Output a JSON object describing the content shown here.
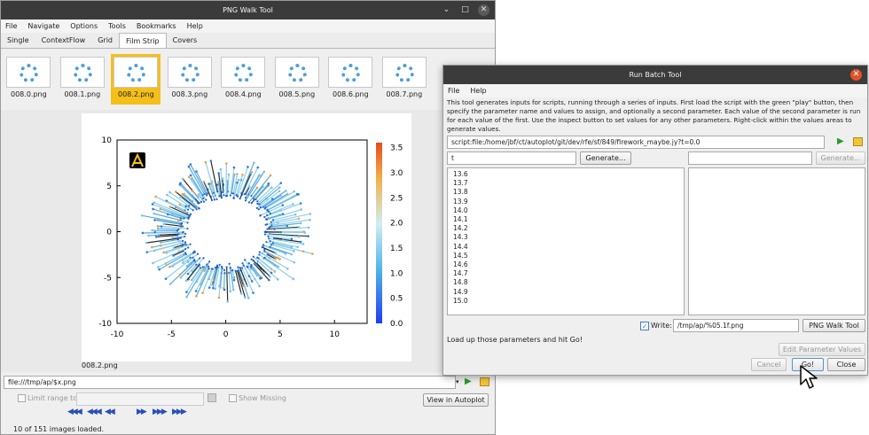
{
  "png_walk": {
    "title": "PNG Walk Tool",
    "menu": [
      "File",
      "Navigate",
      "Options",
      "Tools",
      "Bookmarks",
      "Help"
    ],
    "tabs": [
      "Single",
      "ContextFlow",
      "Grid",
      "Film Strip",
      "Covers"
    ],
    "active_tab": "Film Strip",
    "thumbnails": [
      "008.0.png",
      "008.1.png",
      "008.2.png",
      "008.3.png",
      "008.4.png",
      "008.5.png",
      "008.6.png",
      "008.7.png"
    ],
    "selected_thumbnail": "008.2.png",
    "image_caption": "008.2.png",
    "url_field": "file:///tmp/ap/$x.png",
    "limit_range_label": "Limit range to:",
    "show_missing_label": "Show Missing",
    "view_in_autoplot": "View in Autoplot",
    "status": "10 of 151 images loaded."
  },
  "chart_data": {
    "type": "scatter",
    "x_ticks": [
      "-10",
      "-5",
      "0",
      "5",
      "10"
    ],
    "y_ticks": [
      "10",
      "5",
      "0",
      "-5",
      "-10"
    ],
    "xlim": [
      -10,
      13
    ],
    "ylim": [
      -10,
      10
    ],
    "colorbar_ticks": [
      "3.5",
      "3.0",
      "2.5",
      "2.0",
      "1.5",
      "1.0",
      "0.5",
      "0.0"
    ],
    "colorbar_range": [
      0,
      3.6
    ],
    "ring_center": [
      0,
      0
    ],
    "ring_inner_radius": 3.5,
    "ring_outer_radius": 6.5
  },
  "batch": {
    "title": "Run Batch Tool",
    "menu": [
      "File",
      "Help"
    ],
    "description": "This tool generates inputs for scripts, running through a series of inputs. First load the script with the green \"play\" button, then specify the parameter name and values to assign, and optionally a second parameter. Each value of the second parameter is run for each value of the first. Use the inspect button to set values for any other parameters. Right-click within the values areas to generate values.",
    "script_field": "script:file:/home/jbf/ct/autoplot/git/dev/rfe/sf/849/firework_maybe.jy?t=0.0",
    "param1": "t",
    "param2": "",
    "generate_label": "Generate...",
    "generate2_label": "Generate...",
    "values": [
      "13.6",
      "13.7",
      "13.8",
      "13.9",
      "14.0",
      "14.1",
      "14.2",
      "14.3",
      "14.4",
      "14.5",
      "14.6",
      "14.7",
      "14.8",
      "14.9",
      "15.0"
    ],
    "write_label": "Write:",
    "write_checked": true,
    "write_path": "/tmp/ap/%05.1f.png",
    "png_walk_button": "PNG Walk Tool",
    "status": "Load up those parameters and hit Go!",
    "edit_params": "Edit Parameter Values",
    "cancel": "Cancel",
    "go": "Go!",
    "close": "Close"
  }
}
